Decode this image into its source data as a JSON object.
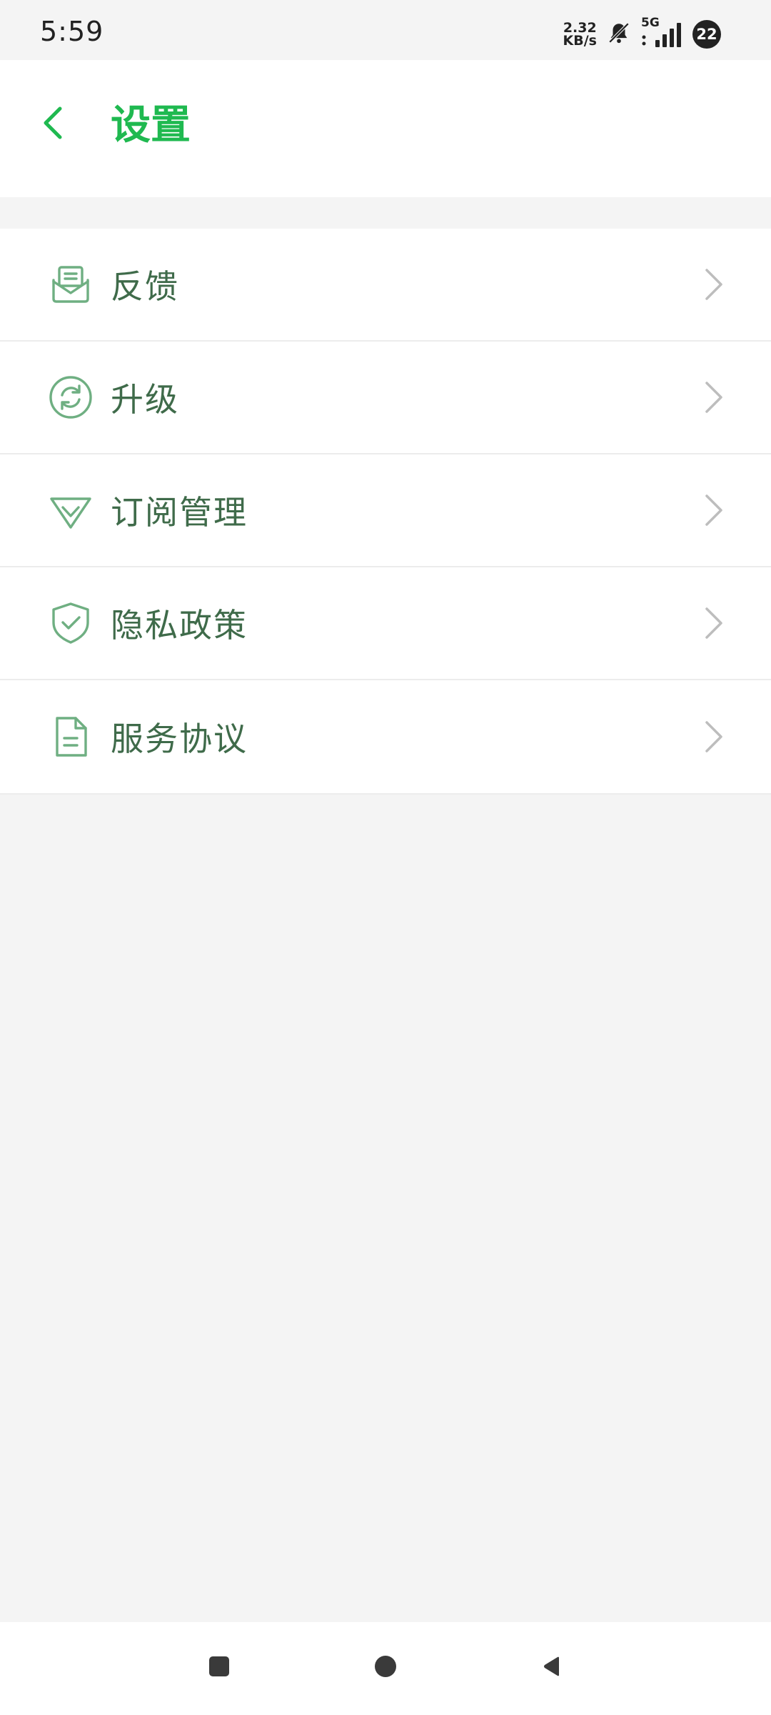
{
  "status_bar": {
    "time": "5:59",
    "net_speed_value": "2.32",
    "net_speed_unit": "KB/s",
    "network_type": "5G",
    "battery": "22"
  },
  "header": {
    "title": "设置"
  },
  "settings": {
    "items": [
      {
        "label": "反馈",
        "icon": "feedback-mail-icon"
      },
      {
        "label": "升级",
        "icon": "refresh-icon"
      },
      {
        "label": "订阅管理",
        "icon": "diamond-icon"
      },
      {
        "label": "隐私政策",
        "icon": "shield-check-icon"
      },
      {
        "label": "服务协议",
        "icon": "document-icon"
      }
    ]
  },
  "colors": {
    "accent": "#1fb950",
    "icon": "#6faf82",
    "label": "#3f6b4a",
    "chevron": "#bdbdbd",
    "background": "#f4f4f4"
  }
}
